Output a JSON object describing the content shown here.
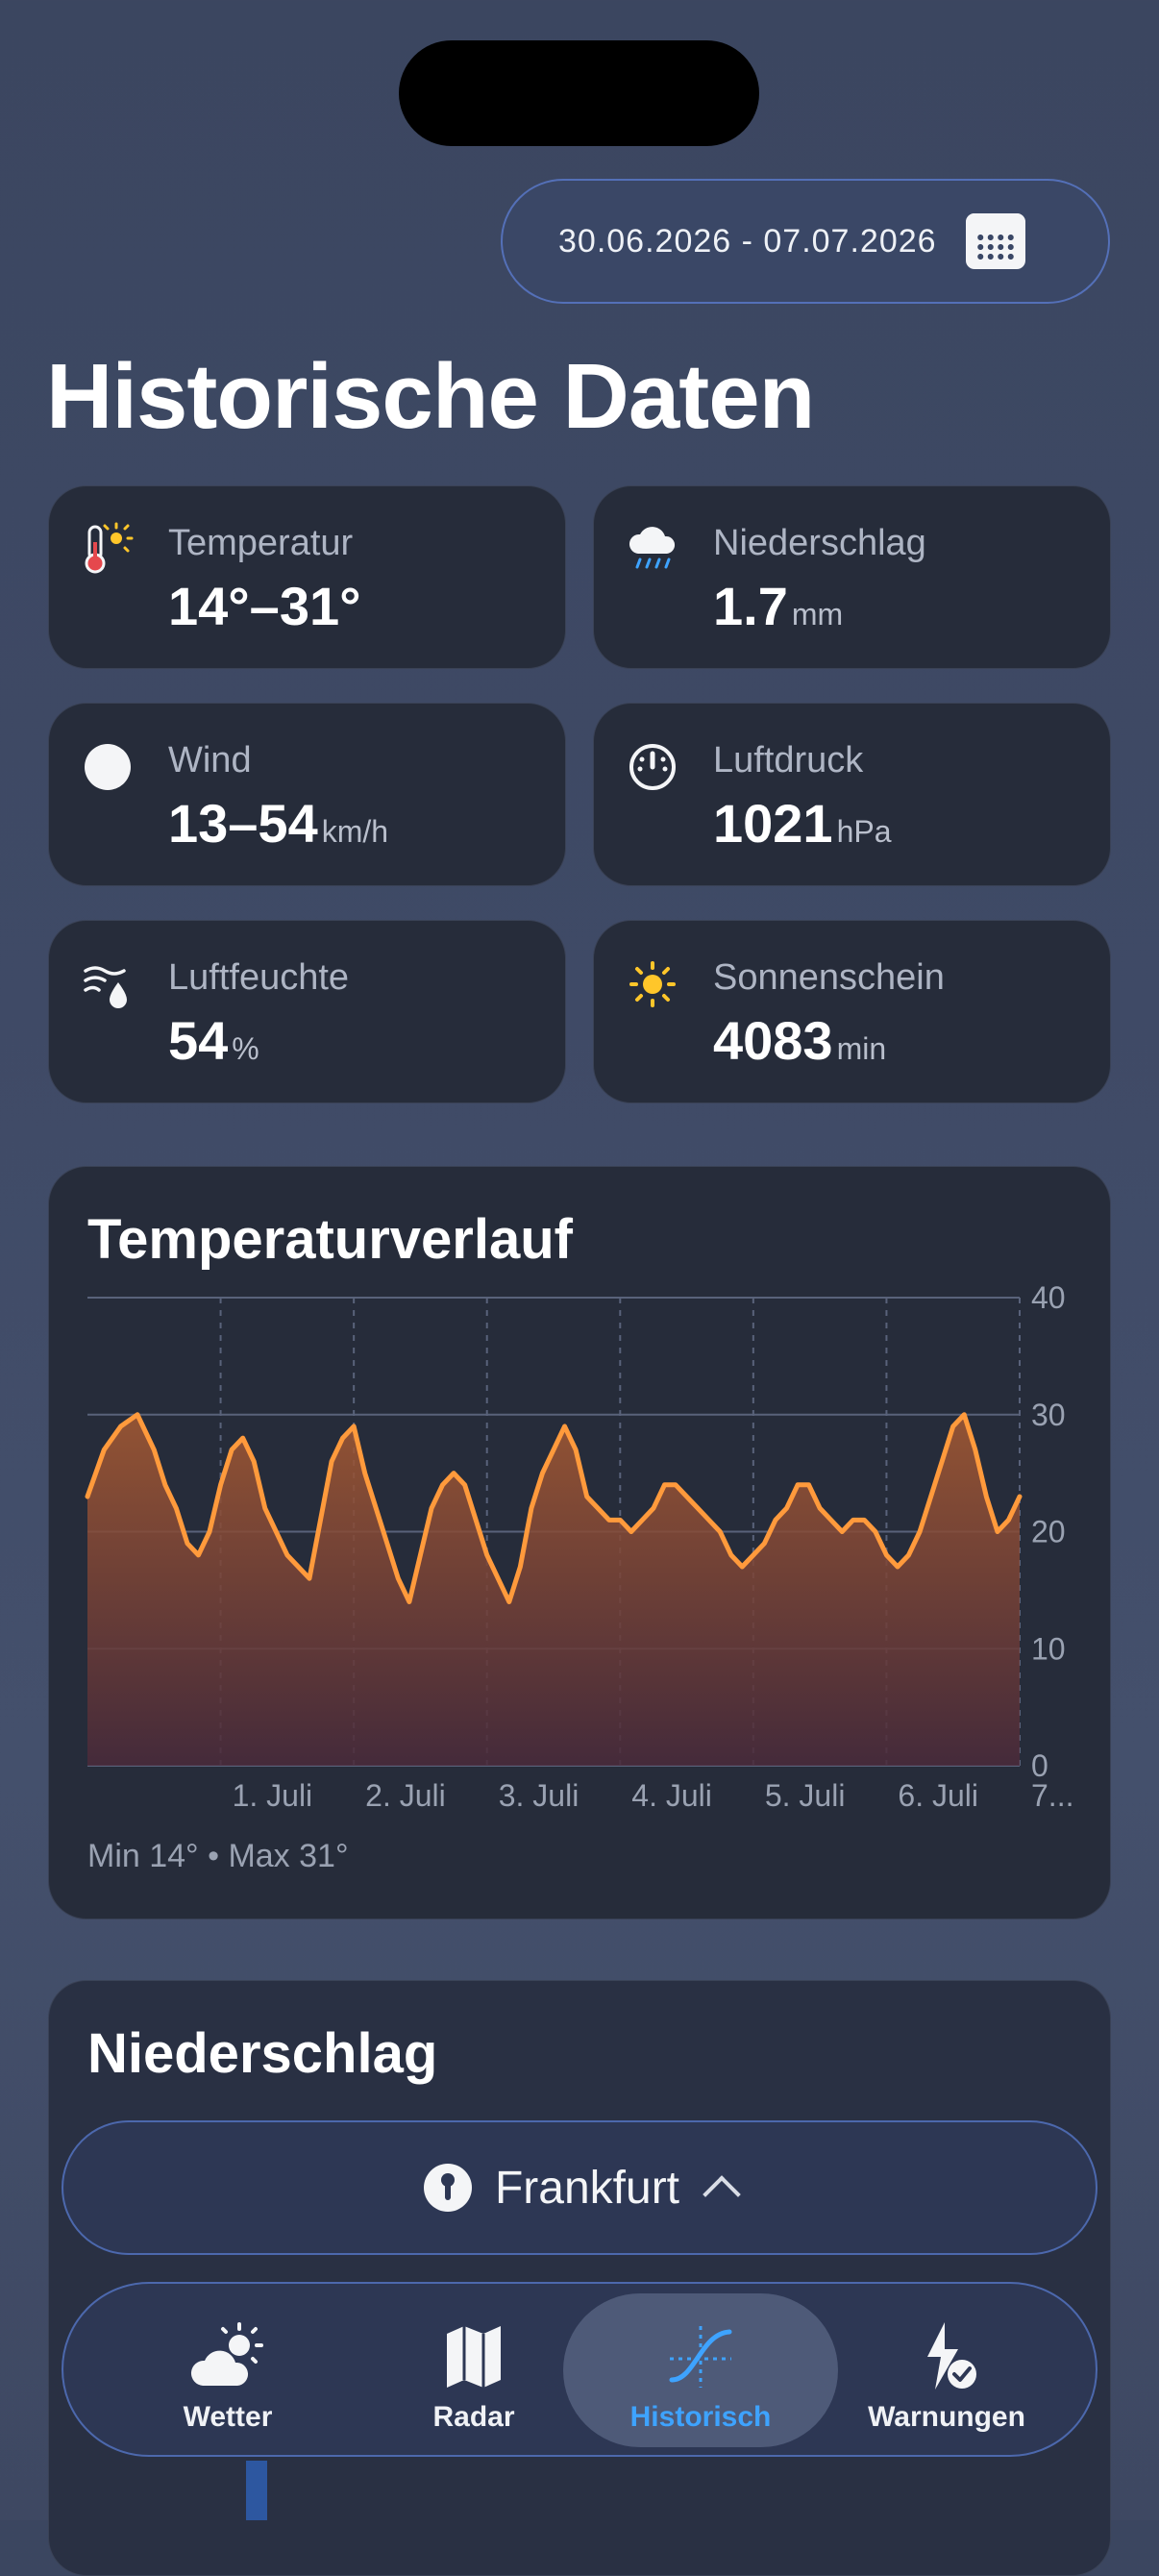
{
  "header": {
    "date_range": "30.06.2026 - 07.07.2026",
    "calendar_icon": "calendar-icon",
    "title": "Historische Daten"
  },
  "stats": [
    {
      "label": "Temperatur",
      "value": "14°–31°",
      "unit": "",
      "icon": "thermometer-sun-icon"
    },
    {
      "label": "Niederschlag",
      "value": "1.7",
      "unit": "mm",
      "icon": "rain-cloud-icon"
    },
    {
      "label": "Wind",
      "value": "13–54",
      "unit": "km/h",
      "icon": "wind-dot-icon"
    },
    {
      "label": "Luftdruck",
      "value": "1021",
      "unit": "hPa",
      "icon": "gauge-icon"
    },
    {
      "label": "Luftfeuchte",
      "value": "54",
      "unit": "%",
      "icon": "humidity-icon"
    },
    {
      "label": "Sonnenschein",
      "value": "4083",
      "unit": "min",
      "icon": "sun-icon"
    }
  ],
  "temperature_chart": {
    "title": "Temperaturverlauf",
    "minmax": "Min 14° • Max 31°"
  },
  "precip_section": {
    "title": "Niederschlag"
  },
  "location": {
    "name": "Frankfurt"
  },
  "tabs": [
    {
      "label": "Wetter",
      "icon": "weather-icon"
    },
    {
      "label": "Radar",
      "icon": "map-icon"
    },
    {
      "label": "Historisch",
      "icon": "history-curve-icon"
    },
    {
      "label": "Warnungen",
      "icon": "warning-bolt-icon"
    }
  ],
  "colors": {
    "line": "#ff9a3c",
    "accent": "#3ea3ff",
    "sun": "#ffc62a"
  },
  "chart_data": {
    "type": "area",
    "title": "Temperaturverlauf",
    "xlabel": "",
    "ylabel": "",
    "ylim": [
      0,
      40
    ],
    "yticks": [
      0,
      10,
      20,
      30,
      40
    ],
    "xticks": [
      "1. Juli",
      "2. Juli",
      "3. Juli",
      "4. Juli",
      "5. Juli",
      "6. Juli",
      "7..."
    ],
    "x_unit": "hours since 30.06.2026 00:00",
    "grid": true,
    "series": [
      {
        "values_x": [
          0,
          3,
          6,
          9,
          12,
          14,
          16,
          18,
          20,
          22,
          24,
          26,
          28,
          30,
          32,
          34,
          36,
          38,
          40,
          42,
          44,
          46,
          48,
          50,
          52,
          54,
          56,
          58,
          60,
          62,
          64,
          66,
          68,
          70,
          72,
          74,
          76,
          78,
          80,
          82,
          84,
          86,
          88,
          90,
          92,
          94,
          96,
          98,
          100,
          102,
          104,
          106,
          108,
          110,
          112,
          114,
          116,
          118,
          120,
          122,
          124,
          126,
          128,
          130,
          132,
          134,
          136,
          138,
          140,
          142,
          144,
          146,
          148,
          150,
          152,
          154,
          156,
          158,
          160,
          162,
          164,
          166,
          168
        ],
        "values_y": [
          23,
          27,
          29,
          30,
          27,
          24,
          22,
          19,
          18,
          20,
          24,
          27,
          28,
          26,
          22,
          20,
          18,
          17,
          16,
          21,
          26,
          28,
          29,
          25,
          22,
          19,
          16,
          14,
          18,
          22,
          24,
          25,
          24,
          21,
          18,
          16,
          14,
          17,
          22,
          25,
          27,
          29,
          27,
          23,
          22,
          21,
          21,
          20,
          21,
          22,
          24,
          24,
          23,
          22,
          21,
          20,
          18,
          17,
          18,
          19,
          21,
          22,
          24,
          24,
          22,
          21,
          20,
          21,
          21,
          20,
          18,
          17,
          18,
          20,
          23,
          26,
          29,
          30,
          27,
          23,
          20,
          21,
          23
        ]
      }
    ]
  }
}
